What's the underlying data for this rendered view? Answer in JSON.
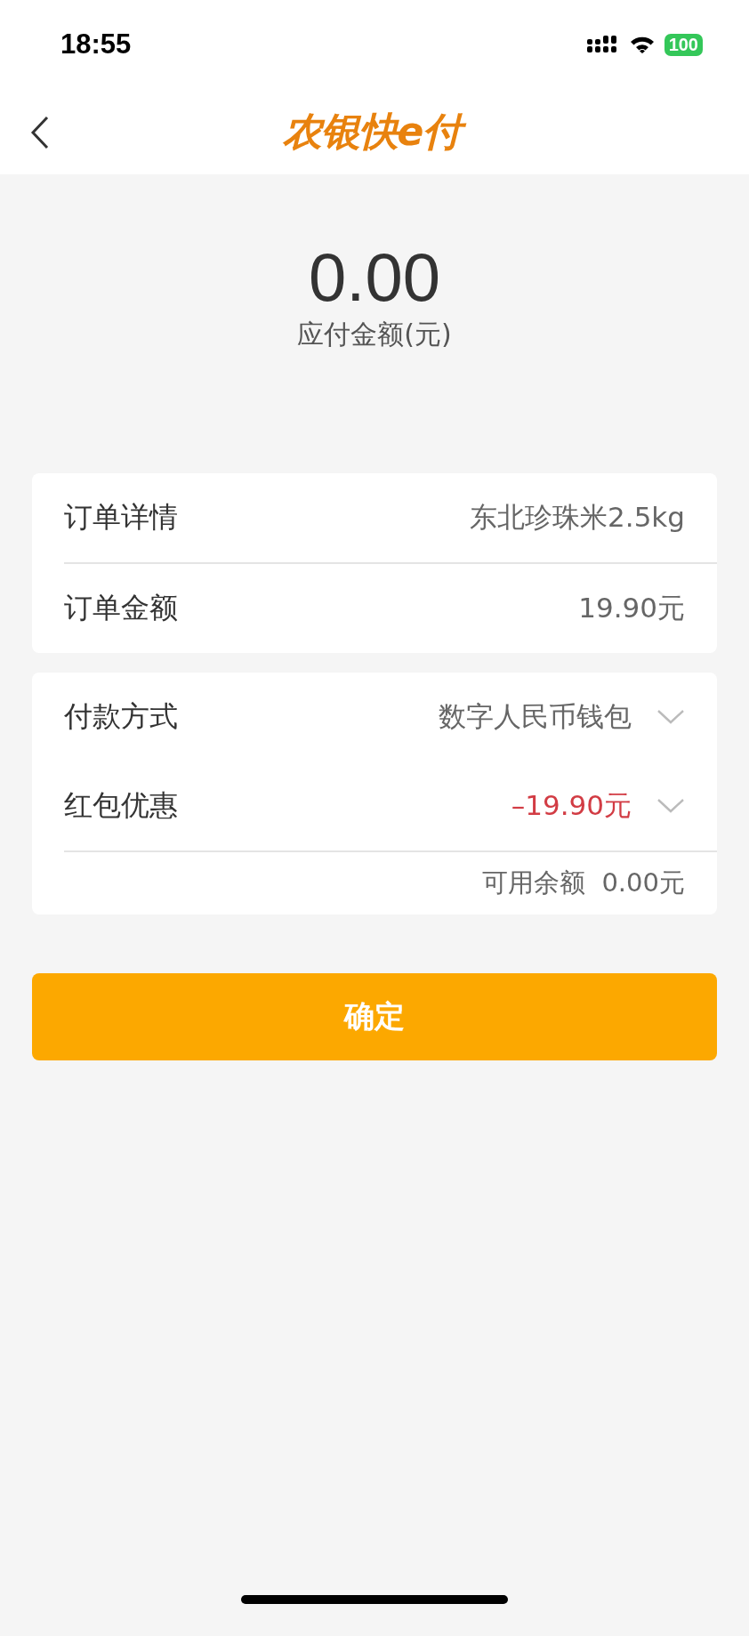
{
  "status_bar": {
    "time": "18:55",
    "battery": "100"
  },
  "header": {
    "logo": "农银快e付"
  },
  "amount": {
    "value": "0.00",
    "label": "应付金额(元)"
  },
  "order_card": {
    "rows": [
      {
        "label": "订单详情",
        "value": "东北珍珠米2.5kg",
        "color": "#666666"
      },
      {
        "label": "订单金额",
        "value": "19.90元",
        "color": "#666666"
      }
    ]
  },
  "payment_card": {
    "rows": [
      {
        "label": "付款方式",
        "value": "数字人民币钱包",
        "kind": "select",
        "color": "#666666"
      },
      {
        "label": "红包优惠",
        "value": "–19.90元",
        "kind": "select",
        "color": "#d23c44"
      }
    ],
    "balance": {
      "label": "可用余额",
      "value": "0.00元"
    }
  },
  "confirm_button": "确定"
}
